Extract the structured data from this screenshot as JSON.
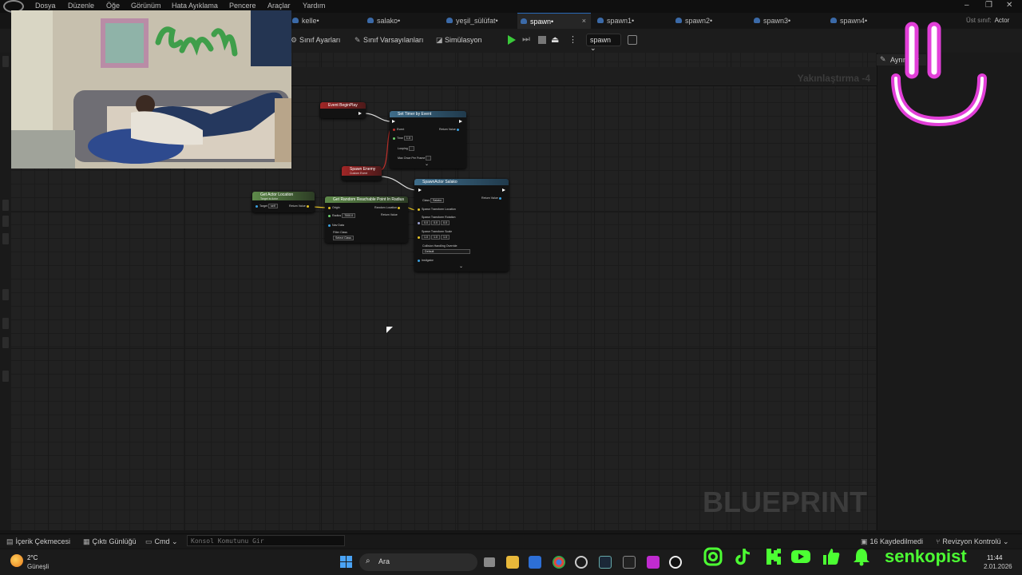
{
  "menu": [
    "Dosya",
    "Düzenle",
    "Öğe",
    "Görünüm",
    "Hata Ayıklama",
    "Pencere",
    "Araçlar",
    "Yardım"
  ],
  "parent_class": {
    "key": "Üst sınıf:",
    "value": "Actor"
  },
  "tabs": [
    {
      "label": "kelle•"
    },
    {
      "label": "salako•"
    },
    {
      "label": "yeşil_sülüfat•"
    },
    {
      "label": "spawn•",
      "close": "×"
    },
    {
      "label": "spawn1•"
    },
    {
      "label": "spawn2•"
    },
    {
      "label": "spawn3•"
    },
    {
      "label": "spawn4•"
    }
  ],
  "toolbar": {
    "class_settings": "Sınıf Ayarları",
    "class_defaults": "Sınıf Varsayılanları",
    "simulation": "Simülasyon",
    "debug_object": "spawn"
  },
  "graph": {
    "zoom": "Yakınlaştırma -4",
    "watermark": "BLUEPRINT",
    "nodes": {
      "begin_play": {
        "title": "Event BeginPlay"
      },
      "set_timer": {
        "title": "Set Timer by Event",
        "event": "Event",
        "time": "Time",
        "time_val": "1.0",
        "looping": "Looping",
        "max_once": "Max Once Per Frame",
        "return": "Return Value"
      },
      "spawn_enemy": {
        "title": "Spawn Enemy",
        "subtitle": "Custom Event"
      },
      "get_actor_location": {
        "title": "Get Actor Location",
        "subtitle": "Target is Actor",
        "target": "Target",
        "target_val": "self",
        "return": "Return Value"
      },
      "random_point": {
        "title": "Get Random Reachable Point In Radius",
        "origin": "Origin",
        "radius": "Radius",
        "radius_val": "7000.0",
        "nav_data": "Nav Data",
        "filter_class": "Filter Class",
        "filter_val": "Select Class",
        "random_location": "Random Location",
        "return": "Return Value"
      },
      "spawn_actor": {
        "title": "SpawnActor Salako",
        "class": "Class",
        "class_val": "Salako",
        "return": "Return Value",
        "location": "Spawn Transform Location",
        "rotation": "Spawn Transform Rotation",
        "rot_vals": [
          "0.0",
          "0.0",
          "0.0"
        ],
        "scale": "Spawn Transform Scale",
        "scale_vals": [
          "1.0",
          "1.0",
          "1.0"
        ],
        "collision": "Collision Handling Override",
        "collision_val": "Default",
        "instigator": "Instigator"
      }
    }
  },
  "details": {
    "tab": "Ayrıntılar"
  },
  "bottom": {
    "content_drawer": "İçerik Çekmecesi",
    "output_log": "Çıktı Günlüğü",
    "cmd": "Cmd",
    "console_placeholder": "Konsol Komutunu Gir",
    "unsaved": "16 Kaydedilmedi",
    "revision": "Revizyon Kontrolü"
  },
  "taskbar": {
    "temp": "2°C",
    "weather": "Güneşli",
    "search": "Ara",
    "time": "11:44",
    "date": "2.01.2026"
  },
  "overlay": {
    "handle": "senkopist",
    "graffiti": "Senko"
  },
  "colors": {
    "accent": "#2a6ab8",
    "social_green": "#4cff33",
    "smiley": "#e23fd8",
    "exec_red": "#a02626"
  }
}
